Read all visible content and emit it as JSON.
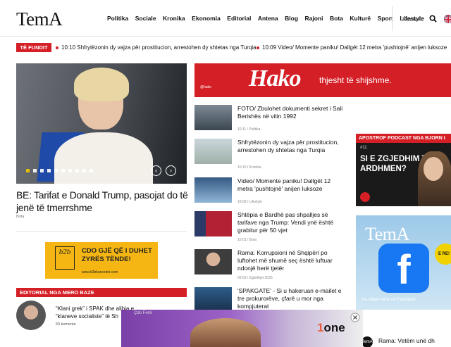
{
  "header": {
    "logo": "TemA",
    "nav": [
      "Politika",
      "Sociale",
      "Kronika",
      "Ekonomia",
      "Editorial",
      "Antena",
      "Blog",
      "Rajoni",
      "Bota",
      "Kulturë",
      "Sport",
      "Lifestyle"
    ],
    "kontakt": "Kontakt"
  },
  "ticker": {
    "badge": "TË FUNDIT",
    "items": [
      {
        "time": "10:10",
        "text": "Shfrytëzonin dy vajza për prostitucion, arrestohen dy shtetas nga Turqia"
      },
      {
        "time": "10:09",
        "text": "Video/ Momente paniku! Dallgët 12 metra 'pushtojnë' anijen luksoze"
      }
    ]
  },
  "hero": {
    "title": "BE: Tarifat e Donald Trump, pasojat do të jenë të tmerrshme",
    "category": "Bota",
    "prev": "‹",
    "next": "›"
  },
  "b2b": {
    "logo": "b2b",
    "line1": "CDO GJË QË I DUHET",
    "line2": "ZYRËS TËNDE!",
    "url": "www.b2bkanceleri.com"
  },
  "editorial": {
    "badge": "EDITORIAL NGA MERO BAZE",
    "text": "“Klani grek” i SPAK dhe alibia e “klaneve socialiste” të Sh",
    "comments": "50 komente"
  },
  "hako": {
    "logo": "Hako",
    "slogan": "thjesht të shijshme.",
    "small": "@hako"
  },
  "list": [
    {
      "title": "FOTO/ Zbulohet dokumenti sekret i Sali Berishës në vitin 1992",
      "meta": "10:11 / Politika"
    },
    {
      "title": "Shfrytëzonin dy vajza për prostitucion, arrestohen dy shtetas nga Turqia",
      "meta": "10:10 / Kronika"
    },
    {
      "title": "Video/ Momente paniku! Dallgët 12 metra 'pushtojnë' anijen luksoze",
      "meta": "10:09 / Lifestyle"
    },
    {
      "title": "Shtëpia e Bardhë pas shpalljes së tarifave nga Trump: Vendi ynë është grabitur për 50 vjet",
      "meta": "10:01 / Bota"
    },
    {
      "title": "Rama: Korrupsioni në Shqipëri po luftohet më shumë seç është luftuar ndonjë herë tjetër",
      "meta": "09:53 / Zgjedhjet 2025"
    },
    {
      "title": "'SPAKGATE' - Si u hakeruan e-mailet e tre prokurorëve, çfarë u mor nga kompjuterat",
      "meta": ""
    }
  ],
  "podcast": {
    "badge": "APOSTROF PODCAST NGA BJORN I",
    "num": "#11",
    "title": "SI E ZGJEDHIM TË ARDHMEN?"
  },
  "fb_ad": {
    "brand": "TemA",
    "letter": "f",
    "circle": "E RE!",
    "caption": "Na ndiqni edhe në Facebook."
  },
  "bottom_right": {
    "logo": "TemA",
    "title": "Rama: Vetëm unë dh"
  },
  "one_ad": {
    "label": "Çdo Femi",
    "logo_num": "1",
    "logo_text": "one"
  }
}
